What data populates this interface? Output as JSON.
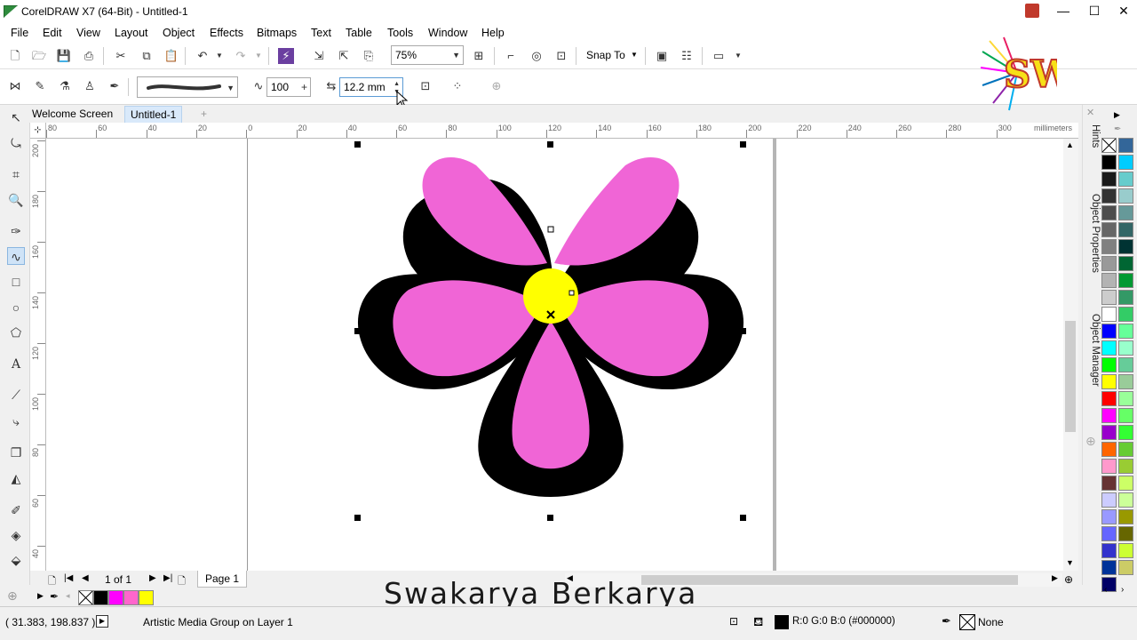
{
  "window": {
    "title": "CorelDRAW X7 (64-Bit) - Untitled-1",
    "minimize": "—",
    "maximize": "☐",
    "close": "✕"
  },
  "menu": [
    "File",
    "Edit",
    "View",
    "Layout",
    "Object",
    "Effects",
    "Bitmaps",
    "Text",
    "Table",
    "Tools",
    "Window",
    "Help"
  ],
  "toolbar": {
    "zoom_level": "75%",
    "snap_to": "Snap To"
  },
  "property_bar": {
    "smoothing_value": "100",
    "stroke_width": "12.2 mm"
  },
  "tabs": {
    "welcome": "Welcome Screen",
    "document": "Untitled-1"
  },
  "ruler": {
    "units": "millimeters",
    "h_labels": [
      "80",
      "60",
      "40",
      "20",
      "0",
      "20",
      "40",
      "60",
      "80",
      "100",
      "120",
      "140",
      "160",
      "180",
      "200",
      "220",
      "240",
      "260",
      "280",
      "300"
    ],
    "v_labels": [
      "200",
      "180",
      "160",
      "140",
      "120",
      "100",
      "80",
      "60",
      "40"
    ]
  },
  "page_nav": {
    "counter": "1 of 1",
    "page_tab": "Page 1"
  },
  "dockers": [
    "Hints",
    "Object Properties",
    "Object Manager"
  ],
  "palette_colors": [
    "#000000",
    "#1a1a1a",
    "#333333",
    "#4d4d4d",
    "#666666",
    "#808080",
    "#999999",
    "#b3b3b3",
    "#cccccc",
    "#ffffff",
    "#0000ff",
    "#00ffff",
    "#00ff00",
    "#ffff00",
    "#ff0000",
    "#ff00ff",
    "#9900cc",
    "#ff6600",
    "#ff99cc",
    "#663333",
    "#ccccff",
    "#9999ff",
    "#6666ff",
    "#3333cc",
    "#003399",
    "#000066"
  ],
  "palette_colors2": [
    "#336699",
    "#00ccff",
    "#66cccc",
    "#99cccc",
    "#669999",
    "#336666",
    "#003333",
    "#006633",
    "#009933",
    "#339966",
    "#33cc66",
    "#66ff99",
    "#99ffcc",
    "#66cc99",
    "#99cc99",
    "#99ff99",
    "#66ff66",
    "#33ff33",
    "#66cc33",
    "#99cc33",
    "#ccff66",
    "#ccff99",
    "#999900",
    "#666600",
    "#ccff33",
    "#cccc66"
  ],
  "doc_palette": [
    "#ffffff",
    "#000000",
    "#ff00ff",
    "#ff66cc",
    "#ffff00"
  ],
  "status": {
    "coordinates": "( 31.383, 198.837 )",
    "selection": "Artistic Media Group on Layer 1",
    "fill": "R:0 G:0 B:0 (#000000)",
    "outline": "None"
  },
  "watermark": "Swakarya Berkarya",
  "logo_text": "SW",
  "colors": {
    "petal_fill": "#f065d6",
    "petal_outline": "#000000",
    "center_fill": "#ffff00"
  }
}
